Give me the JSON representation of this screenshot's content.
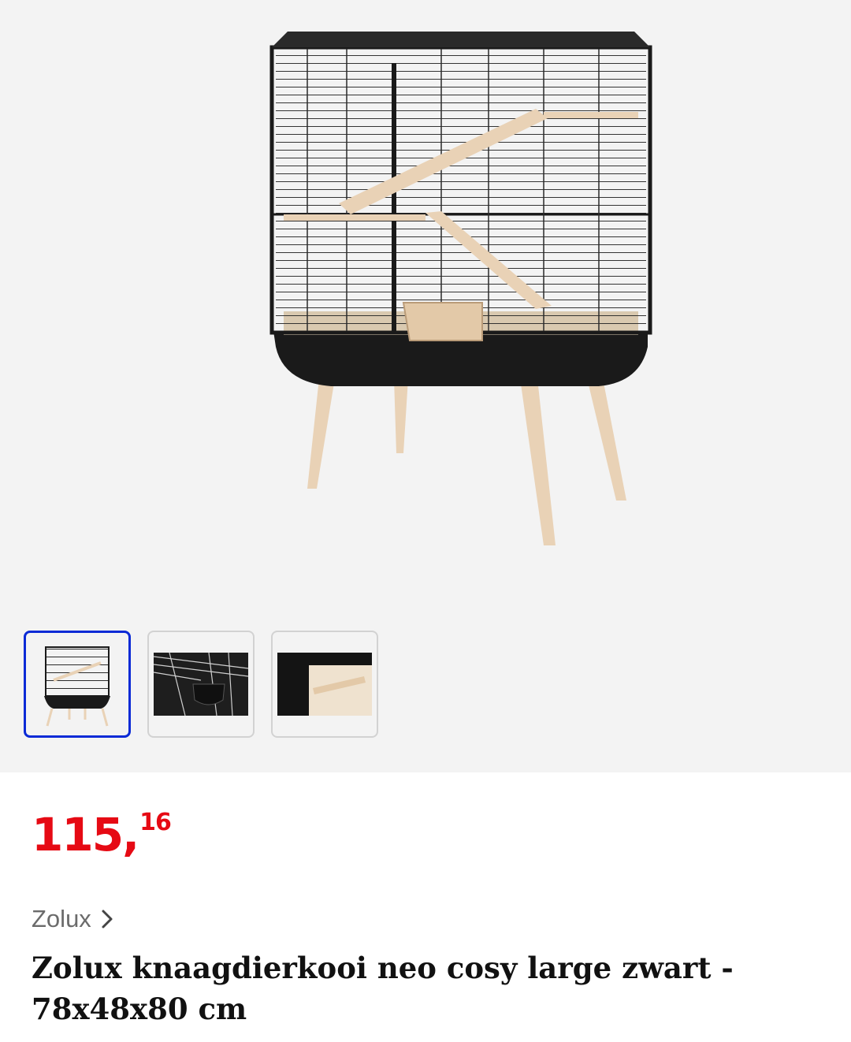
{
  "gallery": {
    "main_image_alt": "",
    "thumbnails": [
      {
        "selected": true
      },
      {
        "selected": false
      },
      {
        "selected": false
      }
    ]
  },
  "product": {
    "price": {
      "whole": "115",
      "separator": ",",
      "cents": "16",
      "color": "#e60a14"
    },
    "brand": "Zolux",
    "brand_chevron_icon": "chevron-right-icon",
    "title": "Zolux knaagdierkooi neo cosy large zwart - 78x48x80 cm"
  },
  "colors": {
    "accent_selected": "#0a2ad6",
    "gallery_bg": "#f3f3f3"
  }
}
